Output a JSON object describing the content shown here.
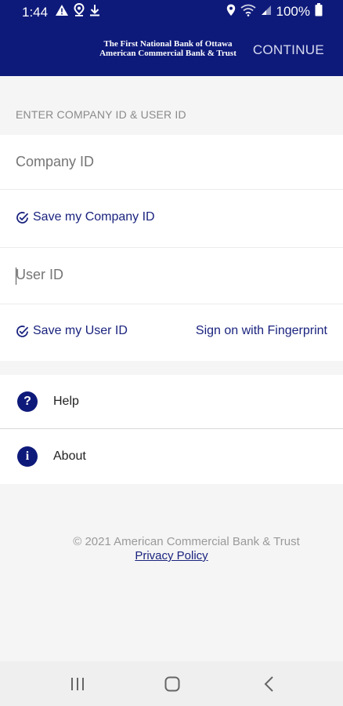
{
  "status_bar": {
    "time": "1:44",
    "battery": "100%",
    "icons_left": [
      "warning-icon",
      "location-pin-icon",
      "download-icon"
    ],
    "icons_right": [
      "location-icon",
      "wifi-icon",
      "signal-icon",
      "battery-icon"
    ]
  },
  "header": {
    "bank_line1": "The First National Bank of Ottawa",
    "bank_line2": "American Commercial Bank & Trust",
    "continue_label": "CONTINUE"
  },
  "form": {
    "section_label": "ENTER COMPANY ID & USER ID",
    "company_id_placeholder": "Company ID",
    "save_company_label": "Save my Company ID",
    "user_id_placeholder": "User ID",
    "save_user_label": "Save my User ID",
    "fingerprint_label": "Sign on with Fingerprint"
  },
  "menu": {
    "items": [
      {
        "icon_text": "?",
        "label": "Help"
      },
      {
        "icon_text": "i",
        "label": "About"
      }
    ]
  },
  "footer": {
    "copyright": "© 2021 American Commercial Bank & Trust",
    "privacy_label": "Privacy Policy"
  },
  "colors": {
    "header_bg": "#0e1a7a",
    "accent": "#1a237e"
  }
}
